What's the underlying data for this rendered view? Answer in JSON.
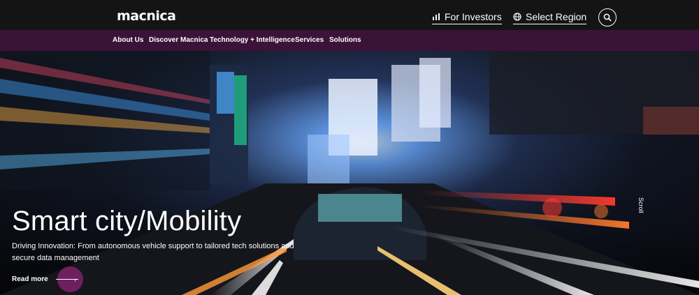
{
  "brand": {
    "logo_text": "macnica"
  },
  "header": {
    "investors_label": "For Investors",
    "region_label": "Select Region"
  },
  "nav": {
    "items": [
      {
        "label": "About Us"
      },
      {
        "label": "Discover Macnica"
      },
      {
        "label": "Technology + Intelligence"
      },
      {
        "label": "Services"
      },
      {
        "label": "Solutions"
      }
    ]
  },
  "hero": {
    "title": "Smart city/Mobility",
    "subtitle": "Driving Innovation: From autonomous vehicle support to tailored tech solutions and secure data management",
    "cta_label": "Read more",
    "scroll_label": "Scroll"
  },
  "colors": {
    "topbar": "#141414",
    "nav_bar": "#3b1238",
    "accent": "#6e1f5e"
  },
  "icons": {
    "investors": "chart-icon",
    "region": "globe-icon",
    "search": "search-icon",
    "cta": "arrow-right-icon"
  }
}
